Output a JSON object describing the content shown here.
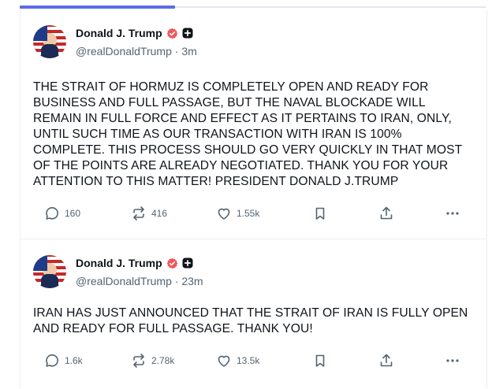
{
  "posts": [
    {
      "author": "Donald J. Trump",
      "handle": "@realDonaldTrump",
      "time": "3m",
      "text": "THE STRAIT OF HORMUZ IS COMPLETELY OPEN AND READY FOR BUSINESS AND FULL PASSAGE, BUT THE NAVAL BLOCKADE WILL REMAIN IN FULL FORCE AND EFFECT AS IT PERTAINS TO IRAN, ONLY, UNTIL SUCH TIME AS OUR TRANSACTION WITH IRAN IS 100% COMPLETE. THIS PROCESS SHOULD GO VERY QUICKLY IN THAT MOST OF THE POINTS ARE ALREADY NEGOTIATED. THANK YOU FOR YOUR ATTENTION TO THIS MATTER! PRESIDENT DONALD J.TRUMP",
      "replies": "160",
      "reposts": "416",
      "likes": "1.55k"
    },
    {
      "author": "Donald J. Trump",
      "handle": "@realDonaldTrump",
      "time": "23m",
      "text": "IRAN HAS JUST ANNOUNCED THAT THE STRAIT OF IRAN IS FULLY OPEN AND READY FOR FULL PASSAGE. THANK YOU!",
      "replies": "1.6k",
      "reposts": "2.78k",
      "likes": "13.5k"
    }
  ],
  "separator": " · ",
  "tab_progress_fraction": 0.333,
  "colors": {
    "accent": "#5b6ce8",
    "verified": "#f2565b",
    "text": "#0f1419",
    "muted": "#536471"
  },
  "icons": [
    "verified-badge-icon",
    "plus-badge-icon",
    "reply-icon",
    "repost-icon",
    "like-icon",
    "bookmark-icon",
    "share-icon",
    "more-icon"
  ]
}
